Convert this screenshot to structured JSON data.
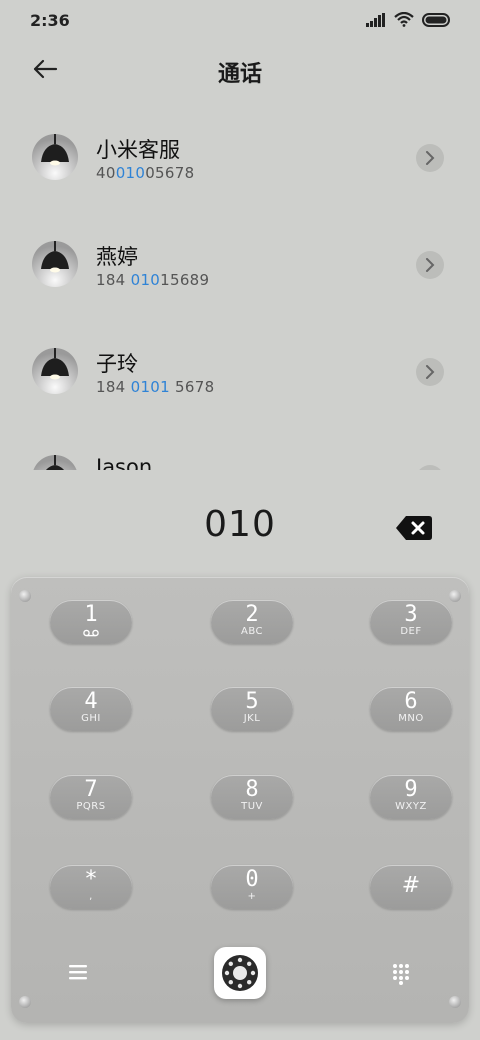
{
  "status_bar": {
    "time": "2:36"
  },
  "header": {
    "title": "通话"
  },
  "contacts": [
    {
      "name": "小米客服",
      "number_pre": "40",
      "number_hl": "010",
      "number_post": "05678"
    },
    {
      "name": "燕婷",
      "number_pre": "184 ",
      "number_hl": "010",
      "number_post": "15689"
    },
    {
      "name": "子玲",
      "number_pre": "184 ",
      "number_hl": "0101",
      "number_post": " 5678"
    },
    {
      "name": "Jason",
      "number_pre": "",
      "number_hl": "",
      "number_post": ""
    }
  ],
  "dialer": {
    "input": "010"
  },
  "keypad": {
    "keys": [
      {
        "digit": "1",
        "letters": ""
      },
      {
        "digit": "2",
        "letters": "ABC"
      },
      {
        "digit": "3",
        "letters": "DEF"
      },
      {
        "digit": "4",
        "letters": "GHI"
      },
      {
        "digit": "5",
        "letters": "JKL"
      },
      {
        "digit": "6",
        "letters": "MNO"
      },
      {
        "digit": "7",
        "letters": "PQRS"
      },
      {
        "digit": "8",
        "letters": "TUV"
      },
      {
        "digit": "9",
        "letters": "WXYZ"
      },
      {
        "digit": "*",
        "letters": ","
      },
      {
        "digit": "0",
        "letters": "+"
      },
      {
        "digit": "#",
        "letters": ""
      }
    ]
  },
  "colors": {
    "highlight": "#2f83d6",
    "background": "#cfd0cd",
    "key": "#a3a3a2"
  },
  "icons": {
    "back": "arrow-left-icon",
    "chevron": "chevron-right-icon",
    "backspace": "backspace-icon",
    "voicemail": "voicemail-icon",
    "menu": "menu-icon",
    "call": "call-dial-icon",
    "grid": "dialpad-grid-icon"
  }
}
